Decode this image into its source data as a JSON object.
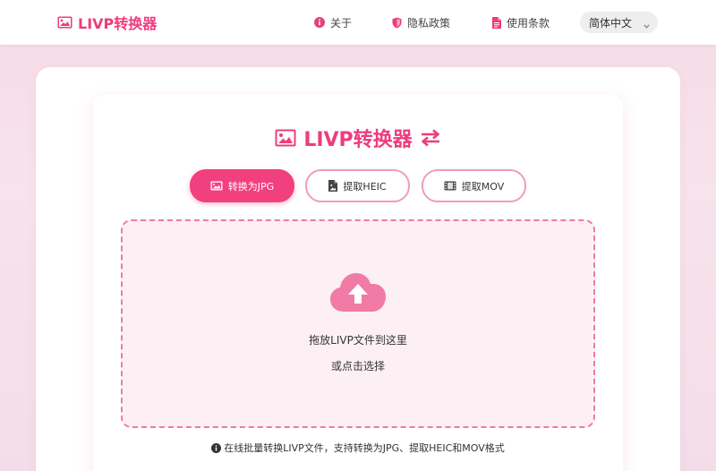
{
  "header": {
    "brand": "LIVP转换器",
    "nav": [
      {
        "label": "关于",
        "icon": "info-circle-icon"
      },
      {
        "label": "隐私政策",
        "icon": "shield-icon"
      },
      {
        "label": "使用条款",
        "icon": "document-icon"
      }
    ],
    "language": "简体中文"
  },
  "main": {
    "title": "LIVP转换器",
    "tabs": [
      {
        "label": "转换为JPG",
        "icon": "image-icon",
        "active": true
      },
      {
        "label": "提取HEIC",
        "icon": "file-image-icon",
        "active": false
      },
      {
        "label": "提取MOV",
        "icon": "film-icon",
        "active": false
      }
    ],
    "dropzone": {
      "primary_text": "拖放LIVP文件到这里",
      "secondary_text": "或点击选择"
    },
    "footer_note": "在线批量转换LIVP文件，支持转换为JPG、提取HEIC和MOV格式"
  },
  "colors": {
    "accent": "#ec3d7c",
    "tab_active": "#f23f7d",
    "dropzone_border": "#ee7aa4",
    "dropzone_bg": "#fdf0f5",
    "upload_icon": "#f17ba5"
  }
}
